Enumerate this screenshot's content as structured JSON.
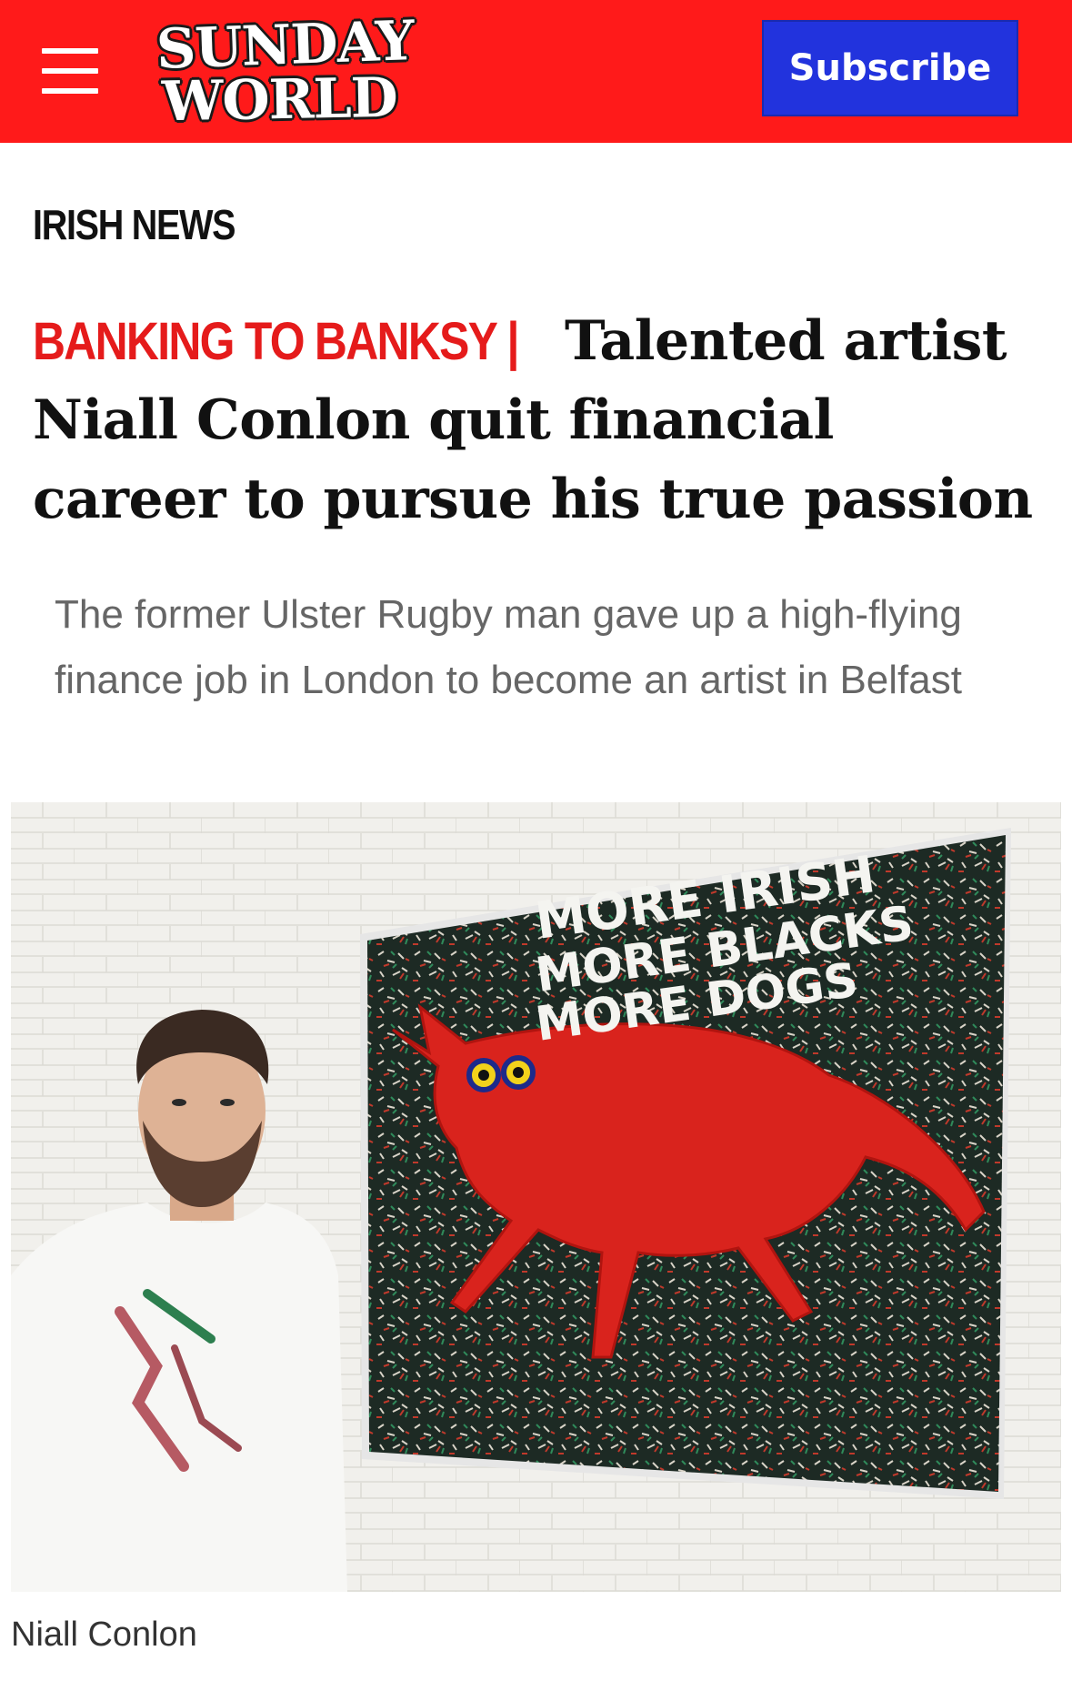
{
  "header": {
    "logo_line1": "SUNDAY",
    "logo_line2": "WORLD",
    "subscribe_label": "Subscribe",
    "brand_color": "#ff1a1a",
    "subscribe_color": "#2233dd",
    "menu_icon": "hamburger-menu-icon"
  },
  "article": {
    "section": "IRISH NEWS",
    "kicker": "BANKING TO BANKSY |",
    "headline": "Talented artist Niall Conlon quit financial career to pursue his true passion",
    "standfirst": "The former Ulster Rugby man gave up a high-flying finance job in London to become an artist in Belfast",
    "kicker_color": "#e51b1b"
  },
  "image": {
    "caption": "Niall Conlon",
    "painting_lines": [
      "MORE IRISH",
      "MORE BLACKS",
      "MORE DOGS"
    ]
  }
}
